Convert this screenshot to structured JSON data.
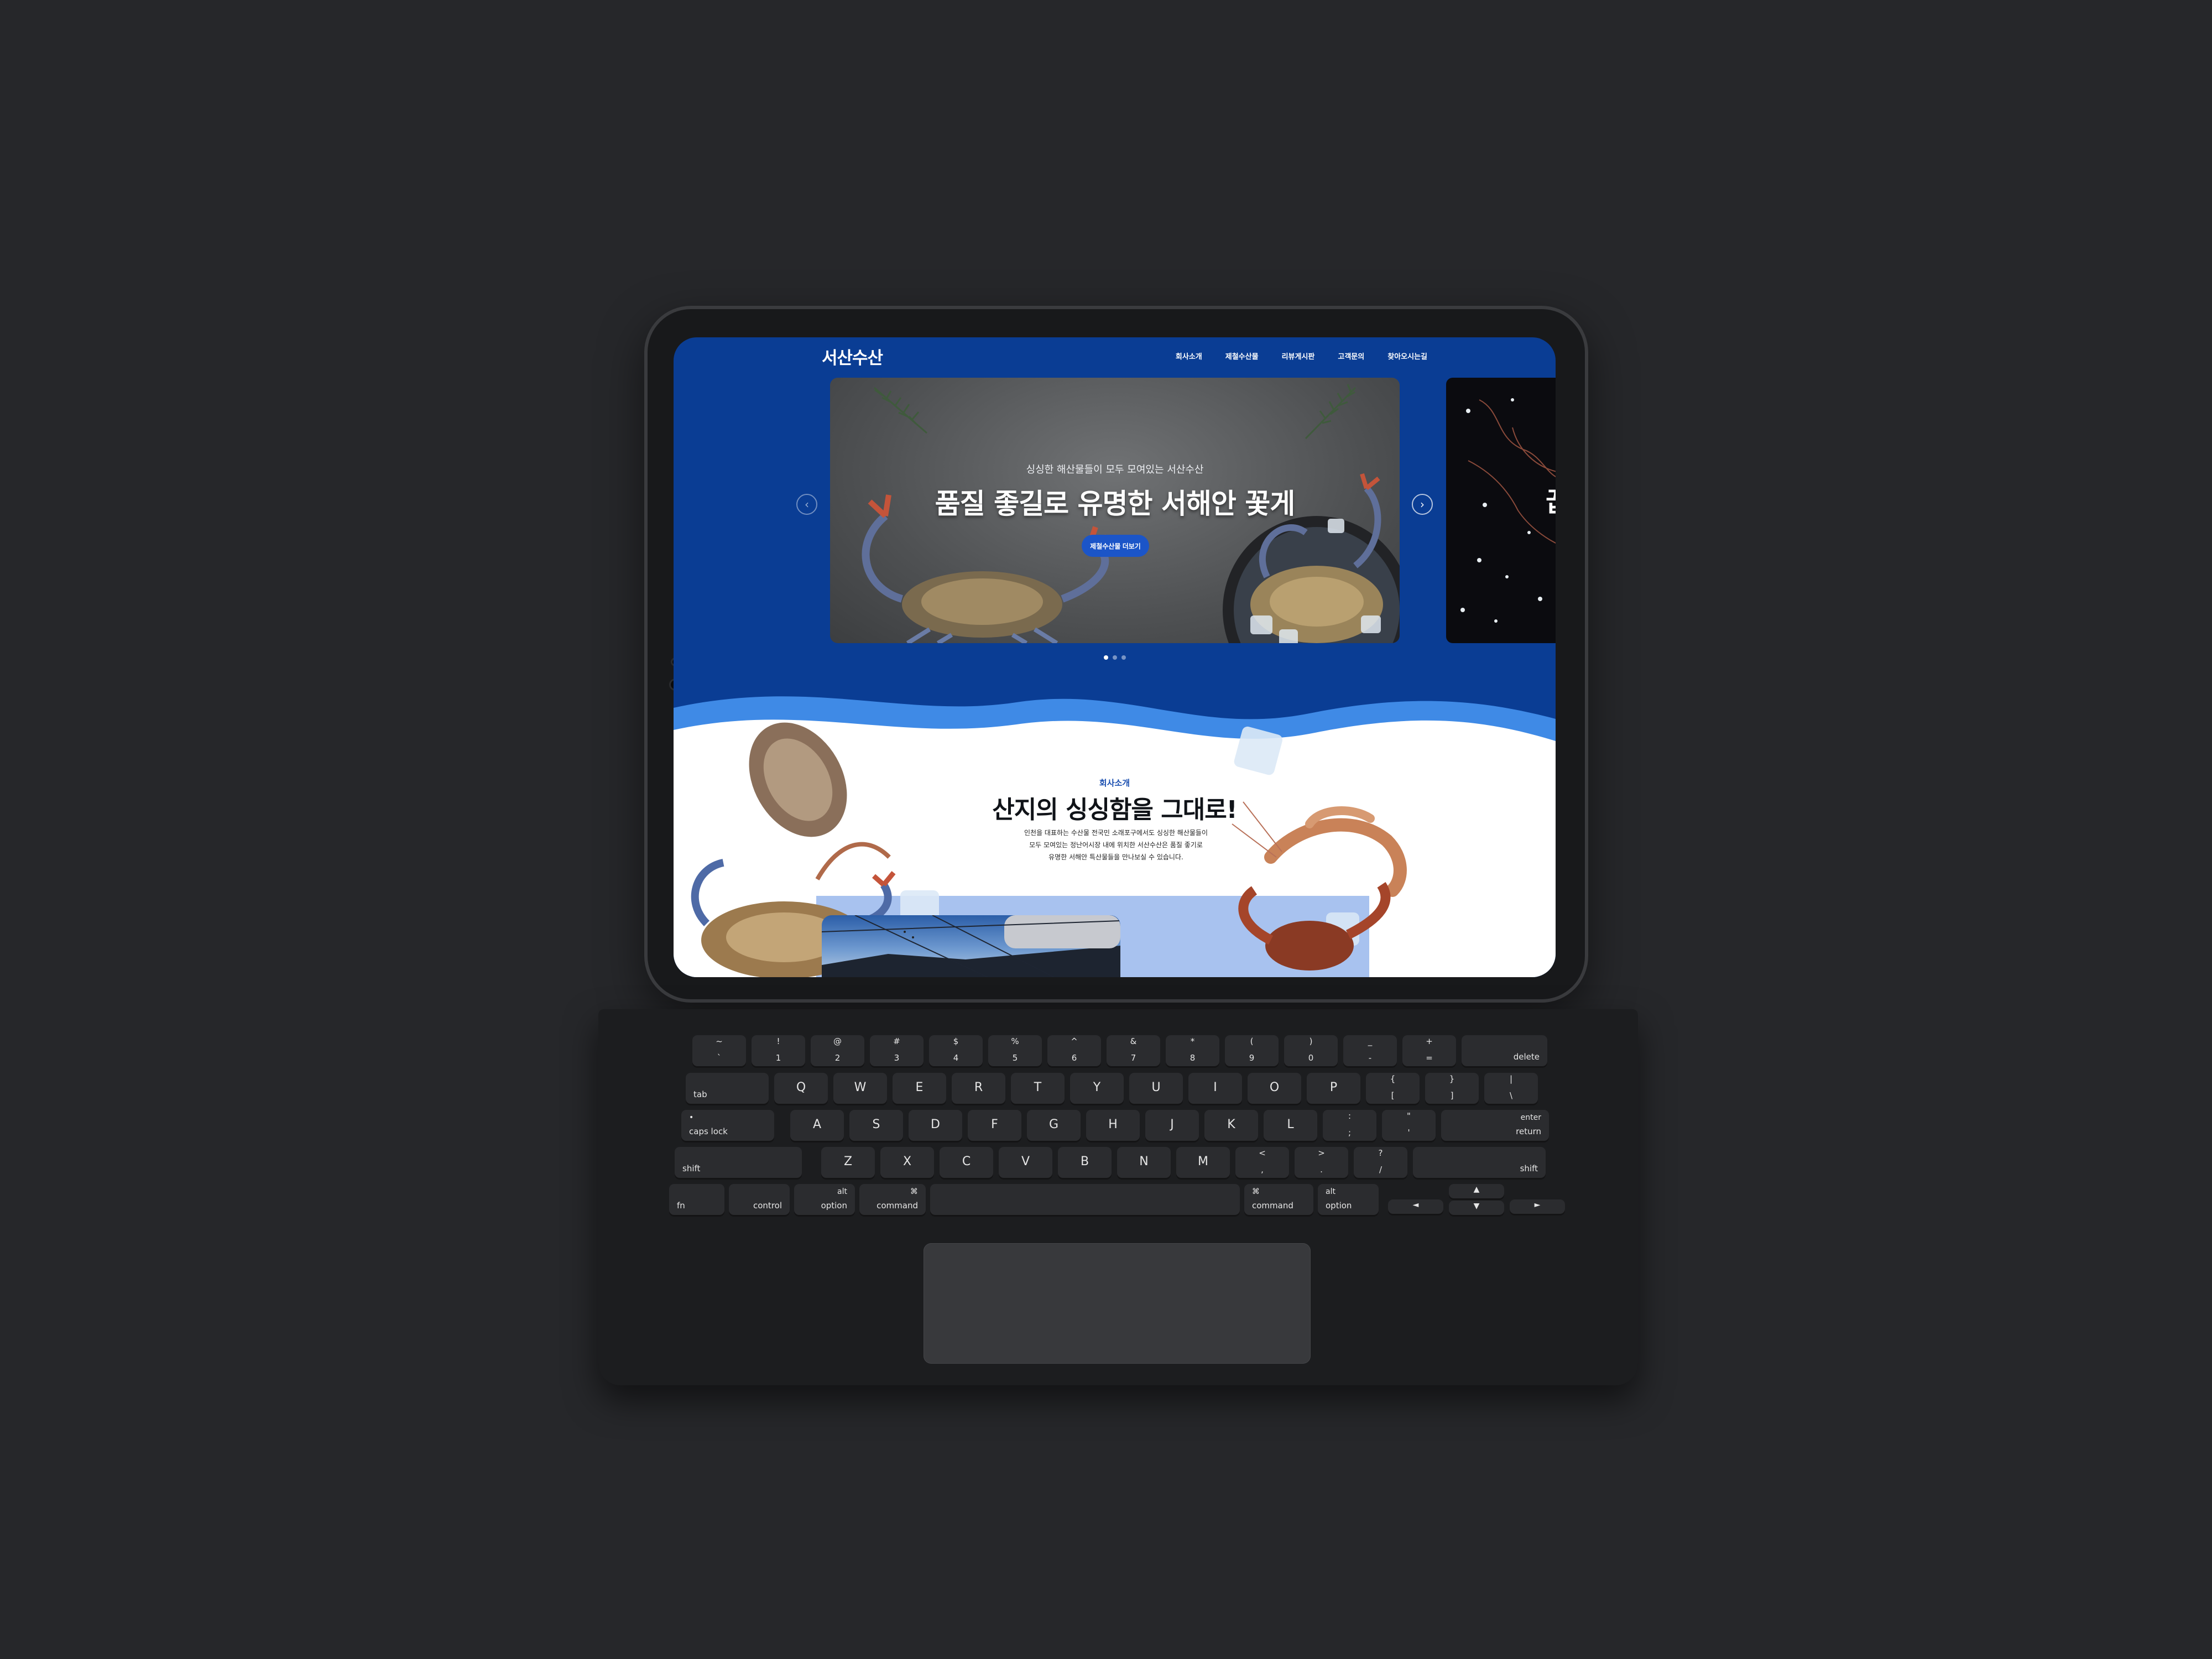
{
  "site": {
    "logo": "서산수산",
    "nav": [
      "회사소개",
      "제철수산물",
      "리뷰게시판",
      "고객문의",
      "찾아오시는길"
    ]
  },
  "hero": {
    "subtitle": "싱싱한 해산물들이 모두 모여있는 서산수산",
    "title": "품질 좋길로 유명한 서해안 꽃게",
    "button": "제철수산물 더보기",
    "next_title_fragment": "꿉",
    "prev_arrow": "‹",
    "next_arrow": "›",
    "dots": 3,
    "active_dot": 1
  },
  "about": {
    "label": "회사소개",
    "title": "산지의 싱싱함을 그대로!",
    "text": [
      "인천을 대표하는 수산물 전국민 소래포구에서도 싱싱한 해산물들이",
      "모두 모여있는 정난어시장 내에 위치한 서산수산은 품질 좋기로",
      "유명한 서해안 특산물들을 만나보실 수 있습니다."
    ]
  },
  "colors": {
    "brand_blue": "#0a3d94",
    "wave_light": "#3f8ae6",
    "button_blue": "#1b55c8",
    "device": "#18191b"
  },
  "keyboard": {
    "row1": [
      [
        "~",
        "`"
      ],
      [
        "!",
        "1"
      ],
      [
        "@",
        "2"
      ],
      [
        "#",
        "3"
      ],
      [
        "$",
        "4"
      ],
      [
        "%",
        "5"
      ],
      [
        "^",
        "6"
      ],
      [
        "&",
        "7"
      ],
      [
        "*",
        "8"
      ],
      [
        "(",
        "9"
      ],
      [
        ")",
        "0"
      ],
      [
        "_",
        "-"
      ],
      [
        "+",
        "="
      ]
    ],
    "delete": "delete",
    "tab": "tab",
    "row2": [
      "Q",
      "W",
      "E",
      "R",
      "T",
      "Y",
      "U",
      "I",
      "O",
      "P"
    ],
    "row2_extra": [
      [
        "{",
        "["
      ],
      [
        "}",
        "]"
      ],
      [
        "|",
        "\\"
      ]
    ],
    "caps_dot": "•",
    "caps": "caps lock",
    "row3": [
      "A",
      "S",
      "D",
      "F",
      "G",
      "H",
      "J",
      "K",
      "L"
    ],
    "row3_extra": [
      [
        ":",
        ";"
      ],
      [
        "\"",
        "'"
      ]
    ],
    "enter": "enter",
    "return": "return",
    "shift": "shift",
    "row4": [
      "Z",
      "X",
      "C",
      "V",
      "B",
      "N",
      "M"
    ],
    "row4_extra": [
      [
        "<",
        ","
      ],
      [
        ">",
        "."
      ],
      [
        "?",
        "/"
      ]
    ],
    "fn": "fn",
    "control": "control",
    "alt": "alt",
    "option": "option",
    "cmd_symbol": "⌘",
    "command": "command",
    "arrows": [
      "◄",
      "▲",
      "▼",
      "►"
    ]
  }
}
